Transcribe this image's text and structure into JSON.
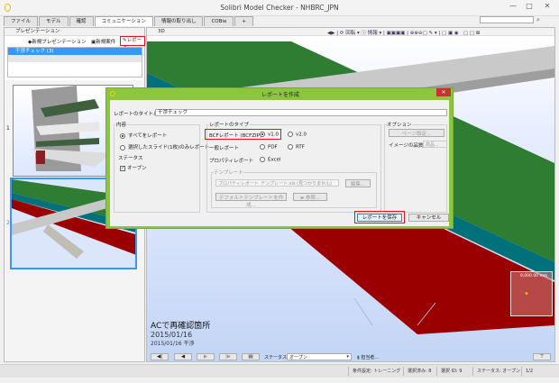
{
  "window": {
    "title": "Solibri Model Checker - NHBRC_JPN",
    "controls": [
      "—",
      "□",
      "✕"
    ]
  },
  "tabs": [
    "ファイル",
    "モデル",
    "確認",
    "コミュニケーション",
    "情報の取り出し",
    "COBie",
    "+"
  ],
  "active_tab": "コミュニケーション",
  "left_panel": {
    "title": "プレゼンテーション",
    "toolbar": {
      "new_presentation": "新規プレゼンテーション",
      "new_issue": "新規案件",
      "report": "レポート"
    },
    "list": [
      {
        "label": "干渉チェック (3)"
      }
    ],
    "slides": [
      {
        "number": "1"
      },
      {
        "number": "2"
      }
    ]
  },
  "view": {
    "title": "3D",
    "toolbar": {
      "rotate": "回転",
      "info": "情報"
    },
    "measure": "9,000.00 mm",
    "slide_title": "ACで再確認箇所",
    "slide_date": "2015/01/16",
    "slide_desc": "2015/01/16 干渉",
    "status_label": "ステータス",
    "status_value": "オープン",
    "assignee": "担当者..."
  },
  "dialog": {
    "title": "レポートを作成",
    "report_title_label": "レポートのタイトル",
    "report_title_value": "干渉チェック",
    "content_group": "内容",
    "content_all": "すべてをレポート",
    "content_selected": "選択したスライド(1枚)のみレポート",
    "status_label": "ステータス",
    "status_open": "オープン",
    "type_group": "レポートのタイプ",
    "bcf_label": "BCFレポート (BCFZIP)",
    "v1": "v1.0",
    "v2": "v2.0",
    "general_label": "一般レポート",
    "pdf": "PDF",
    "rtf": "RTF",
    "property_label": "プロパティレポート",
    "excel": "Excel",
    "template_group": "テンプレート",
    "template_value": "プロパティレポート_テンプレート.xls (見つかりません)",
    "edit": "編集...",
    "create_default": "デフォルトテンプレートを作成...",
    "browse": "参照...",
    "options_group": "オプション",
    "page_setup": "ページ設定...",
    "image_quality_label": "イメージの品質",
    "image_quality_value": "高品...",
    "save": "レポートを保存",
    "cancel": "キャンセル"
  },
  "statusbar": {
    "ruleset": "条件設定: トレーニング",
    "selected": "選択済み: 8",
    "issue_id": "選択 ID: 9",
    "status": "ステータス: オープン",
    "page": "1/2"
  },
  "colors": {
    "dialog_frame": "#8cc63f",
    "selection": "#3399ff",
    "highlight": "#e0141e"
  }
}
